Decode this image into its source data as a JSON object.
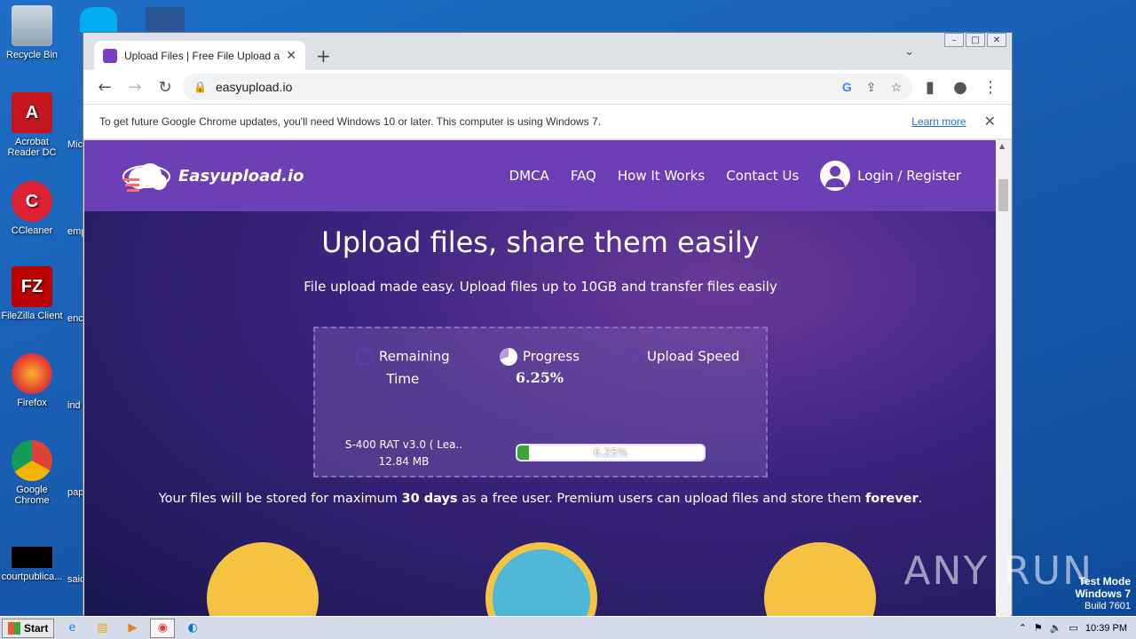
{
  "desktop": {
    "icons": [
      {
        "label": "Recycle Bin"
      },
      {
        "label": "Acrobat Reader DC"
      },
      {
        "label": "CCleaner"
      },
      {
        "label": "FileZilla Client"
      },
      {
        "label": "Firefox"
      },
      {
        "label": "Google Chrome"
      },
      {
        "label": "courtpublica..."
      }
    ],
    "partial_labels": [
      "Mic",
      "emp",
      "enc",
      "ind",
      "pap",
      "saic"
    ]
  },
  "browser": {
    "tab_title": "Upload Files | Free File Upload and T",
    "tab_close": "✕",
    "new_tab": "+",
    "tab_menu": "⌄",
    "url": "easyupload.io",
    "infobar_text": "To get future Google Chrome updates, you'll need Windows 10 or later. This computer is using Windows 7.",
    "infobar_learn": "Learn more",
    "infobar_close": "✕"
  },
  "site": {
    "logo": "Easyupload.io",
    "nav": [
      "DMCA",
      "FAQ",
      "How It Works",
      "Contact Us"
    ],
    "login": "Login / Register",
    "hero_title": "Upload files, share them easily",
    "hero_sub": "File upload made easy. Upload files up to 10GB and transfer files easily",
    "remaining_label_1": "Remaining",
    "remaining_label_2": "Time",
    "progress_label": "Progress",
    "progress_value": "6.25%",
    "speed_label": "Upload Speed",
    "file_name": "S-400 RAT v3.0 ( Lea..",
    "file_size": "12.84 MB",
    "bar_text": "6.25%",
    "bar_fraction": 0.0625,
    "storage_pre": "Your files will be stored for maximum ",
    "storage_days": "30 days",
    "storage_mid": " as a free user. Premium users can upload files and store them ",
    "storage_forever": "forever",
    "storage_end": "."
  },
  "taskbar": {
    "start": "Start",
    "time": "10:39 PM"
  },
  "watermark": "ANY RUN",
  "testmode": {
    "line1": "Test Mode",
    "line2": "Windows 7",
    "line3": "Build 7601"
  },
  "colors": {
    "site_header": "#6b3fb6",
    "progress_fill": "#3aa53a"
  }
}
